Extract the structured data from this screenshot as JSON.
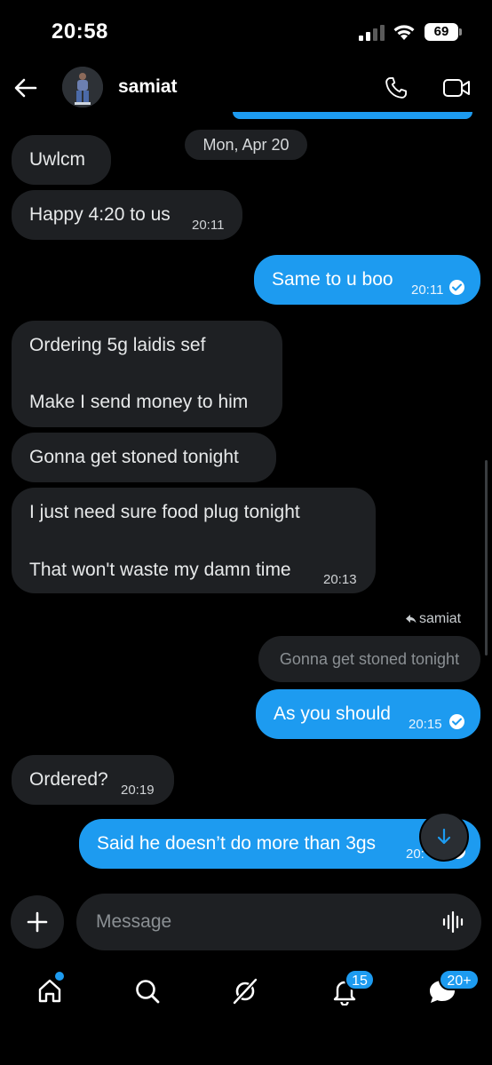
{
  "status_bar": {
    "time": "20:58",
    "battery": "69"
  },
  "header": {
    "contact_name": "samiat"
  },
  "chat": {
    "date_divider": "Mon, Apr 20",
    "messages": [
      {
        "dir": "in",
        "text": "Uwlcm",
        "time": ""
      },
      {
        "dir": "in",
        "text": "Happy 4:20 to us",
        "time": "20:11"
      },
      {
        "dir": "out",
        "text": "Same to u boo",
        "time": "20:11"
      },
      {
        "dir": "in",
        "text": "Ordering 5g laidis sef",
        "text2": "Make I send money to him",
        "time": ""
      },
      {
        "dir": "in",
        "text": "Gonna get stoned tonight",
        "time": ""
      },
      {
        "dir": "in",
        "text": "I just need sure food plug tonight",
        "text2": "That won't waste my damn time",
        "time": "20:13"
      },
      {
        "dir": "out",
        "text": "As you should",
        "time": "20:15",
        "reply_to": "samiat",
        "quoted": "Gonna get stoned tonight"
      },
      {
        "dir": "in",
        "text": "Ordered?",
        "time": "20:19"
      },
      {
        "dir": "out",
        "text": "Said he doesn’t do more than 3gs",
        "time": "20:"
      }
    ]
  },
  "composer": {
    "placeholder": "Message"
  },
  "nav": {
    "notifications_badge": "15",
    "messages_badge": "20+"
  },
  "colors": {
    "accent": "#1d9bf0",
    "bubble_in": "#1e2023",
    "background": "#000000"
  },
  "icons": [
    "back-arrow-icon",
    "phone-icon",
    "video-icon",
    "checkmark-icon",
    "reply-icon",
    "arrow-down-icon",
    "plus-icon",
    "voice-wave-icon",
    "home-icon",
    "search-icon",
    "grok-icon",
    "bell-icon",
    "messages-icon"
  ]
}
